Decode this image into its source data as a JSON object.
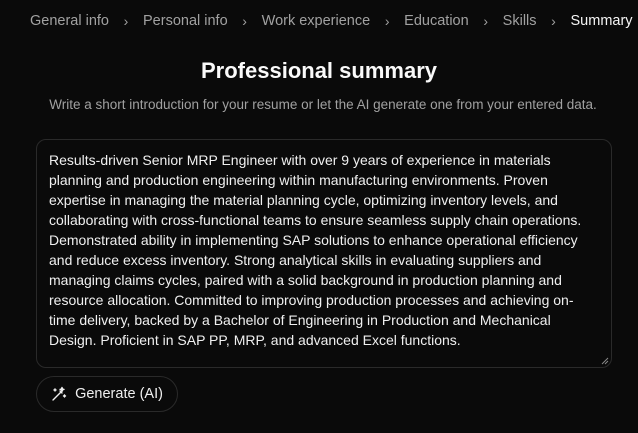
{
  "breadcrumb": {
    "items": [
      "General info",
      "Personal info",
      "Work experience",
      "Education",
      "Skills",
      "Summary"
    ],
    "active_index": 5,
    "separator": "›"
  },
  "page": {
    "title": "Professional summary",
    "subtitle": "Write a short introduction for your resume or let the AI generate one from your entered data."
  },
  "summary": {
    "value": "Results-driven Senior MRP Engineer with over 9 years of experience in materials planning and production engineering within manufacturing environments. Proven expertise in managing the material planning cycle, optimizing inventory levels, and collaborating with cross-functional teams to ensure seamless supply chain operations. Demonstrated ability in implementing SAP solutions to enhance operational efficiency and reduce excess inventory. Strong analytical skills in evaluating suppliers and managing claims cycles, paired with a solid background in production planning and resource allocation. Committed to improving production processes and achieving on-time delivery, backed by a Bachelor of Engineering in Production and Mechanical Design. Proficient in SAP PP, MRP, and advanced Excel functions."
  },
  "actions": {
    "generate_label": "Generate (AI)",
    "generate_icon": "magic-wand-icon"
  }
}
